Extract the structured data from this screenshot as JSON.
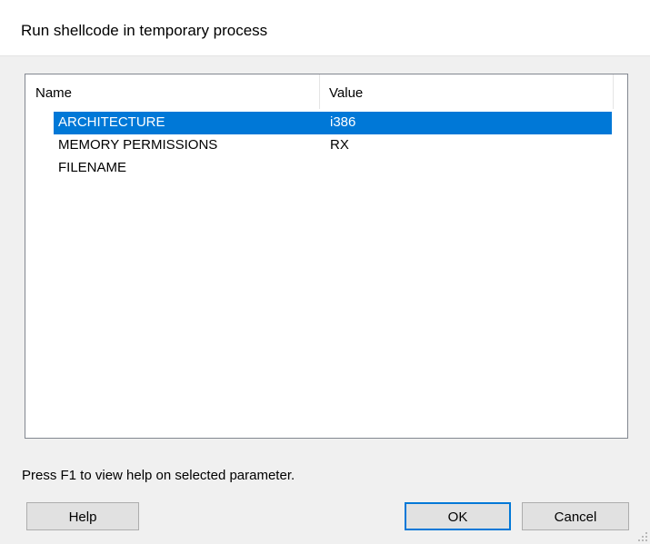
{
  "window": {
    "title": "Run shellcode in temporary process"
  },
  "list": {
    "columns": [
      "Name",
      "Value"
    ],
    "rows": [
      {
        "name": "ARCHITECTURE",
        "value": "i386",
        "selected": true
      },
      {
        "name": "MEMORY PERMISSIONS",
        "value": "RX",
        "selected": false
      },
      {
        "name": "FILENAME",
        "value": "",
        "selected": false
      }
    ]
  },
  "status": {
    "text": "Press F1 to view help on selected parameter."
  },
  "buttons": {
    "help_label": "Help",
    "ok_label": "OK",
    "cancel_label": "Cancel"
  },
  "colors": {
    "selection": "#0078d7",
    "window_bg": "#f0f0f0",
    "title_bg": "#ffffff"
  }
}
